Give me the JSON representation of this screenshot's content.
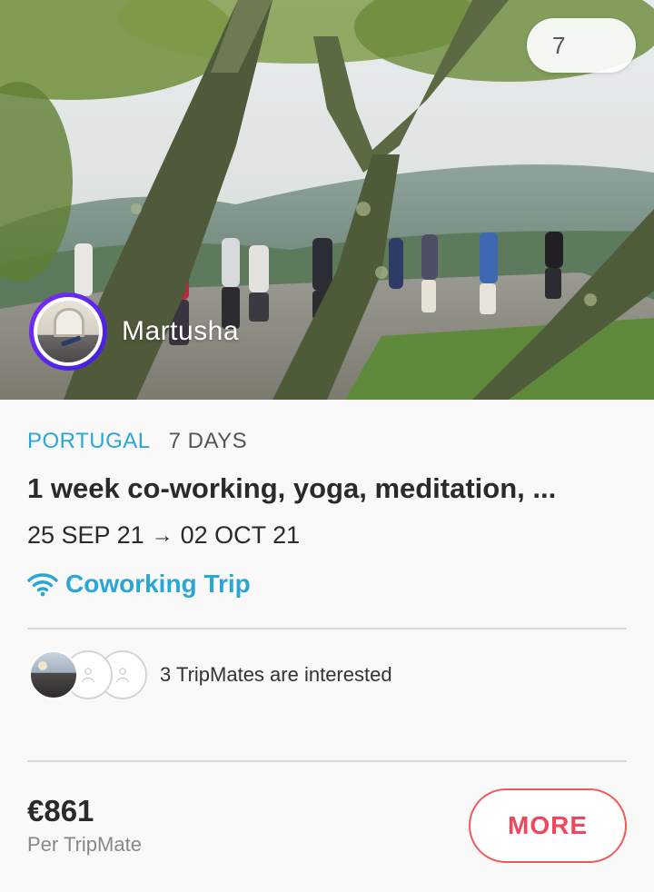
{
  "hero": {
    "likes": "7",
    "host_name": "Martusha"
  },
  "trip": {
    "country": "PORTUGAL",
    "duration": "7 DAYS",
    "title": "1 week co-working, yoga, meditation, ...",
    "start_date": "25 SEP 21",
    "arrow": "→",
    "end_date": "02 OCT 21",
    "type": "Coworking Trip"
  },
  "tripmates": {
    "text": "3 TripMates are interested"
  },
  "pricing": {
    "price": "€861",
    "unit": "Per TripMate"
  },
  "actions": {
    "more_label": "MORE"
  },
  "colors": {
    "accent_blue": "#2aa6d6",
    "accent_red": "#f2465c",
    "avatar_ring": "#5b25ea"
  },
  "icons": [
    "heart-icon",
    "wifi-icon",
    "arrow-right-icon",
    "person-icon"
  ]
}
